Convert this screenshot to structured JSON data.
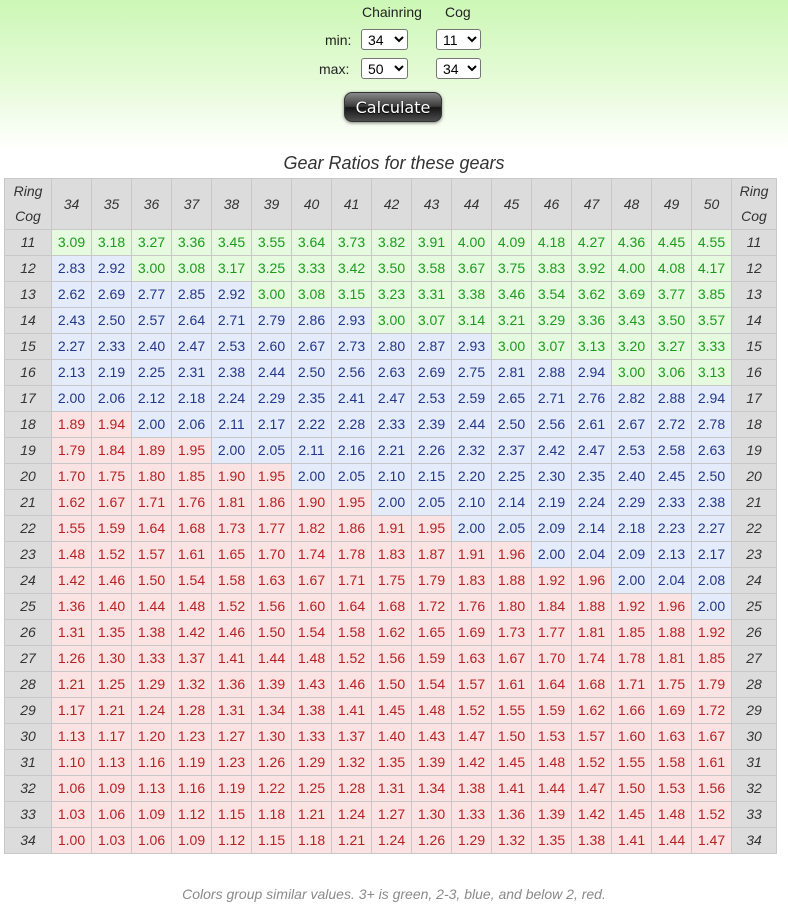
{
  "controls": {
    "chainring_header": "Chainring",
    "cog_header": "Cog",
    "min_label": "min:",
    "max_label": "max:",
    "chainring_min": "34",
    "cog_min": "11",
    "chainring_max": "50",
    "cog_max": "34",
    "calculate_label": "Calculate"
  },
  "table": {
    "title": "Gear Ratios for these gears",
    "corner_ring": "Ring",
    "corner_cog": "Cog",
    "chainrings": [
      "34",
      "35",
      "36",
      "37",
      "38",
      "39",
      "40",
      "41",
      "42",
      "43",
      "44",
      "45",
      "46",
      "47",
      "48",
      "49",
      "50"
    ],
    "cogs": [
      "11",
      "12",
      "13",
      "14",
      "15",
      "16",
      "17",
      "18",
      "19",
      "20",
      "21",
      "22",
      "23",
      "24",
      "25",
      "26",
      "27",
      "28",
      "29",
      "30",
      "31",
      "32",
      "33",
      "34"
    ],
    "rows": [
      [
        "3.09",
        "3.18",
        "3.27",
        "3.36",
        "3.45",
        "3.55",
        "3.64",
        "3.73",
        "3.82",
        "3.91",
        "4.00",
        "4.09",
        "4.18",
        "4.27",
        "4.36",
        "4.45",
        "4.55"
      ],
      [
        "2.83",
        "2.92",
        "3.00",
        "3.08",
        "3.17",
        "3.25",
        "3.33",
        "3.42",
        "3.50",
        "3.58",
        "3.67",
        "3.75",
        "3.83",
        "3.92",
        "4.00",
        "4.08",
        "4.17"
      ],
      [
        "2.62",
        "2.69",
        "2.77",
        "2.85",
        "2.92",
        "3.00",
        "3.08",
        "3.15",
        "3.23",
        "3.31",
        "3.38",
        "3.46",
        "3.54",
        "3.62",
        "3.69",
        "3.77",
        "3.85"
      ],
      [
        "2.43",
        "2.50",
        "2.57",
        "2.64",
        "2.71",
        "2.79",
        "2.86",
        "2.93",
        "3.00",
        "3.07",
        "3.14",
        "3.21",
        "3.29",
        "3.36",
        "3.43",
        "3.50",
        "3.57"
      ],
      [
        "2.27",
        "2.33",
        "2.40",
        "2.47",
        "2.53",
        "2.60",
        "2.67",
        "2.73",
        "2.80",
        "2.87",
        "2.93",
        "3.00",
        "3.07",
        "3.13",
        "3.20",
        "3.27",
        "3.33"
      ],
      [
        "2.13",
        "2.19",
        "2.25",
        "2.31",
        "2.38",
        "2.44",
        "2.50",
        "2.56",
        "2.63",
        "2.69",
        "2.75",
        "2.81",
        "2.88",
        "2.94",
        "3.00",
        "3.06",
        "3.13"
      ],
      [
        "2.00",
        "2.06",
        "2.12",
        "2.18",
        "2.24",
        "2.29",
        "2.35",
        "2.41",
        "2.47",
        "2.53",
        "2.59",
        "2.65",
        "2.71",
        "2.76",
        "2.82",
        "2.88",
        "2.94"
      ],
      [
        "1.89",
        "1.94",
        "2.00",
        "2.06",
        "2.11",
        "2.17",
        "2.22",
        "2.28",
        "2.33",
        "2.39",
        "2.44",
        "2.50",
        "2.56",
        "2.61",
        "2.67",
        "2.72",
        "2.78"
      ],
      [
        "1.79",
        "1.84",
        "1.89",
        "1.95",
        "2.00",
        "2.05",
        "2.11",
        "2.16",
        "2.21",
        "2.26",
        "2.32",
        "2.37",
        "2.42",
        "2.47",
        "2.53",
        "2.58",
        "2.63"
      ],
      [
        "1.70",
        "1.75",
        "1.80",
        "1.85",
        "1.90",
        "1.95",
        "2.00",
        "2.05",
        "2.10",
        "2.15",
        "2.20",
        "2.25",
        "2.30",
        "2.35",
        "2.40",
        "2.45",
        "2.50"
      ],
      [
        "1.62",
        "1.67",
        "1.71",
        "1.76",
        "1.81",
        "1.86",
        "1.90",
        "1.95",
        "2.00",
        "2.05",
        "2.10",
        "2.14",
        "2.19",
        "2.24",
        "2.29",
        "2.33",
        "2.38"
      ],
      [
        "1.55",
        "1.59",
        "1.64",
        "1.68",
        "1.73",
        "1.77",
        "1.82",
        "1.86",
        "1.91",
        "1.95",
        "2.00",
        "2.05",
        "2.09",
        "2.14",
        "2.18",
        "2.23",
        "2.27"
      ],
      [
        "1.48",
        "1.52",
        "1.57",
        "1.61",
        "1.65",
        "1.70",
        "1.74",
        "1.78",
        "1.83",
        "1.87",
        "1.91",
        "1.96",
        "2.00",
        "2.04",
        "2.09",
        "2.13",
        "2.17"
      ],
      [
        "1.42",
        "1.46",
        "1.50",
        "1.54",
        "1.58",
        "1.63",
        "1.67",
        "1.71",
        "1.75",
        "1.79",
        "1.83",
        "1.88",
        "1.92",
        "1.96",
        "2.00",
        "2.04",
        "2.08"
      ],
      [
        "1.36",
        "1.40",
        "1.44",
        "1.48",
        "1.52",
        "1.56",
        "1.60",
        "1.64",
        "1.68",
        "1.72",
        "1.76",
        "1.80",
        "1.84",
        "1.88",
        "1.92",
        "1.96",
        "2.00"
      ],
      [
        "1.31",
        "1.35",
        "1.38",
        "1.42",
        "1.46",
        "1.50",
        "1.54",
        "1.58",
        "1.62",
        "1.65",
        "1.69",
        "1.73",
        "1.77",
        "1.81",
        "1.85",
        "1.88",
        "1.92"
      ],
      [
        "1.26",
        "1.30",
        "1.33",
        "1.37",
        "1.41",
        "1.44",
        "1.48",
        "1.52",
        "1.56",
        "1.59",
        "1.63",
        "1.67",
        "1.70",
        "1.74",
        "1.78",
        "1.81",
        "1.85"
      ],
      [
        "1.21",
        "1.25",
        "1.29",
        "1.32",
        "1.36",
        "1.39",
        "1.43",
        "1.46",
        "1.50",
        "1.54",
        "1.57",
        "1.61",
        "1.64",
        "1.68",
        "1.71",
        "1.75",
        "1.79"
      ],
      [
        "1.17",
        "1.21",
        "1.24",
        "1.28",
        "1.31",
        "1.34",
        "1.38",
        "1.41",
        "1.45",
        "1.48",
        "1.52",
        "1.55",
        "1.59",
        "1.62",
        "1.66",
        "1.69",
        "1.72"
      ],
      [
        "1.13",
        "1.17",
        "1.20",
        "1.23",
        "1.27",
        "1.30",
        "1.33",
        "1.37",
        "1.40",
        "1.43",
        "1.47",
        "1.50",
        "1.53",
        "1.57",
        "1.60",
        "1.63",
        "1.67"
      ],
      [
        "1.10",
        "1.13",
        "1.16",
        "1.19",
        "1.23",
        "1.26",
        "1.29",
        "1.32",
        "1.35",
        "1.39",
        "1.42",
        "1.45",
        "1.48",
        "1.52",
        "1.55",
        "1.58",
        "1.61"
      ],
      [
        "1.06",
        "1.09",
        "1.13",
        "1.16",
        "1.19",
        "1.22",
        "1.25",
        "1.28",
        "1.31",
        "1.34",
        "1.38",
        "1.41",
        "1.44",
        "1.47",
        "1.50",
        "1.53",
        "1.56"
      ],
      [
        "1.03",
        "1.06",
        "1.09",
        "1.12",
        "1.15",
        "1.18",
        "1.21",
        "1.24",
        "1.27",
        "1.30",
        "1.33",
        "1.36",
        "1.39",
        "1.42",
        "1.45",
        "1.48",
        "1.52"
      ],
      [
        "1.00",
        "1.03",
        "1.06",
        "1.09",
        "1.12",
        "1.15",
        "1.18",
        "1.21",
        "1.24",
        "1.26",
        "1.29",
        "1.32",
        "1.35",
        "1.38",
        "1.41",
        "1.44",
        "1.47"
      ]
    ],
    "colors": {
      "green_text": "#1c9a1c",
      "green_bg": "#e6fae0",
      "blue_text": "#22378a",
      "blue_bg": "#e4ebfa",
      "red_text": "#b82020",
      "red_bg": "#fbe3e3"
    }
  },
  "footer": "Colors group similar values. 3+ is green, 2-3, blue, and below 2, red."
}
